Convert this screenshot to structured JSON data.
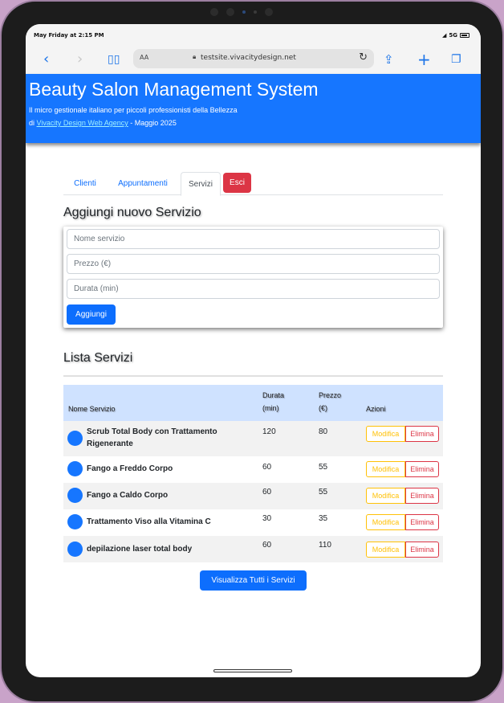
{
  "status": {
    "time": "May Friday at 2:15 PM",
    "signal": "5G"
  },
  "browser": {
    "text_size_label": "AA",
    "url": "testsite.vivacitydesign.net"
  },
  "app": {
    "title": "Beauty Salon Management System",
    "subtitle": "Il micro gestionale italiano per piccoli professionisti della Bellezza",
    "credit_prefix": "di",
    "credit_link": "Vivacity Design Web Agency",
    "credit_suffix": "- Maggio 2025"
  },
  "tabs": [
    {
      "label": "Clienti"
    },
    {
      "label": "Appuntamenti"
    },
    {
      "label": "Servizi"
    },
    {
      "label": "Esci"
    }
  ],
  "add_form": {
    "title": "Aggiungi nuovo Servizio",
    "name_placeholder": "Nome servizio",
    "price_placeholder": "Prezzo (€)",
    "duration_placeholder": "Durata (min)",
    "submit_label": "Aggiungi"
  },
  "list": {
    "title": "Lista Servizi",
    "headers": {
      "name": "Nome Servizio",
      "duration_1": "Durata",
      "duration_2": "(min)",
      "price_1": "Prezzo",
      "price_2": "(€)",
      "actions": "Azioni"
    },
    "rows": [
      {
        "name_1": "Scrub Total Body con Trattamento",
        "name_2": "Rigenerante",
        "duration": "120",
        "price": "80"
      },
      {
        "name_1": "Fango a Freddo Corpo",
        "name_2": "",
        "duration": "60",
        "price": "55"
      },
      {
        "name_1": "Fango a Caldo Corpo",
        "name_2": "",
        "duration": "60",
        "price": "55"
      },
      {
        "name_1": "Trattamento Viso alla Vitamina C",
        "name_2": "",
        "duration": "30",
        "price": "35"
      },
      {
        "name_1": "depilazione laser total body",
        "name_2": "",
        "duration": "60",
        "price": "110"
      }
    ],
    "edit_label": "Modifica",
    "delete_label": "Elimina",
    "view_all_label": "Visualizza Tutti i Servizi"
  },
  "colors": {
    "primary": "#1676ff",
    "danger": "#dc3545",
    "warning": "#ffc107",
    "header_row": "#cfe2ff"
  }
}
